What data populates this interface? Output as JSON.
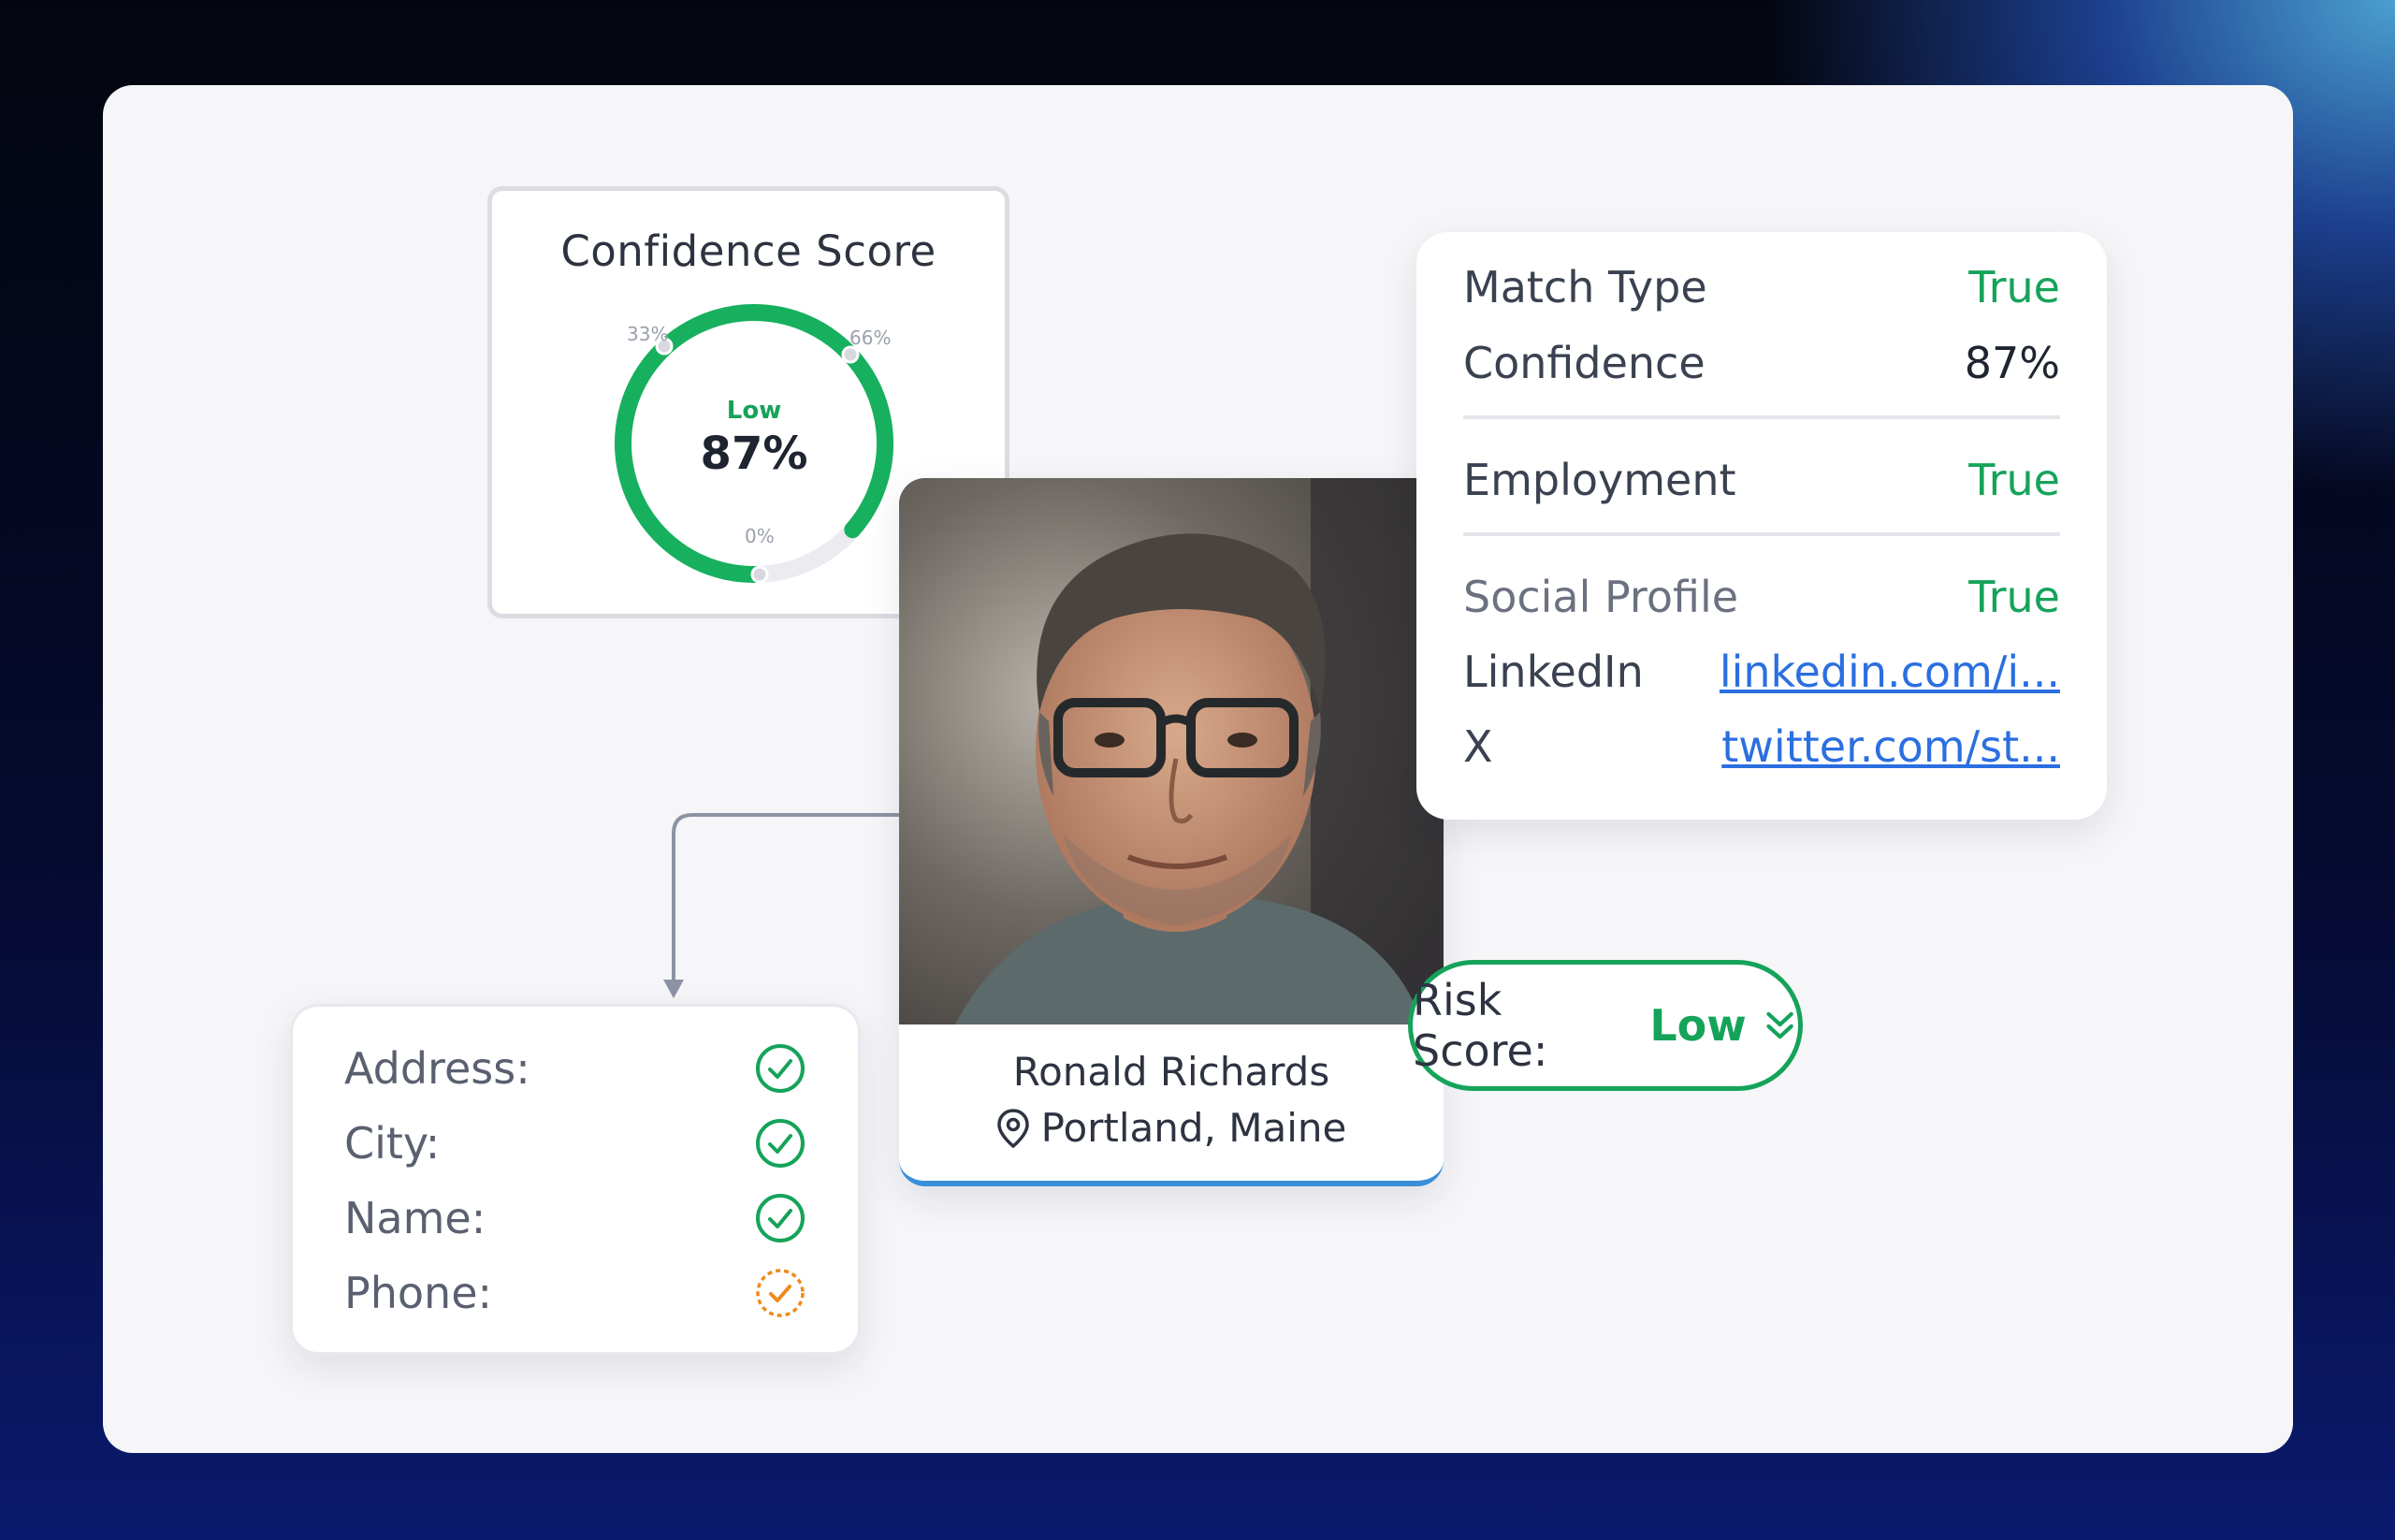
{
  "confidence_card": {
    "title": "Confidence Score",
    "level": "Low",
    "value": "87%",
    "fraction": 0.87,
    "tick_33": "33%",
    "tick_66": "66%",
    "tick_0": "0%"
  },
  "profile": {
    "name": "Ronald Richards",
    "location": "Portland, Maine"
  },
  "match_card": {
    "match_type": {
      "label": "Match Type",
      "value": "True"
    },
    "confidence": {
      "label": "Confidence",
      "value": "87%"
    },
    "employment": {
      "label": "Employment",
      "value": "True"
    },
    "social_profile": {
      "label": "Social Profile",
      "value": "True"
    },
    "linkedin": {
      "label": "LinkedIn",
      "value": "linkedin.com/i..."
    },
    "x": {
      "label": "X",
      "value": "twitter.com/st..."
    }
  },
  "risk": {
    "label": "Risk Score:",
    "value": "Low"
  },
  "checklist": [
    {
      "label": "Address:",
      "status": "verified"
    },
    {
      "label": "City:",
      "status": "verified"
    },
    {
      "label": "Name:",
      "status": "verified"
    },
    {
      "label": "Phone:",
      "status": "partial"
    }
  ],
  "colors": {
    "green": "#15a35a",
    "orange": "#f08a1c",
    "link": "#2b6fe0",
    "accent_blue": "#3a8fd8"
  },
  "icons": {
    "location": "map-pin-icon",
    "risk_toggle": "double-chevron-down-icon",
    "verified": "check-circle-icon",
    "partial": "dashed-check-circle-icon"
  }
}
